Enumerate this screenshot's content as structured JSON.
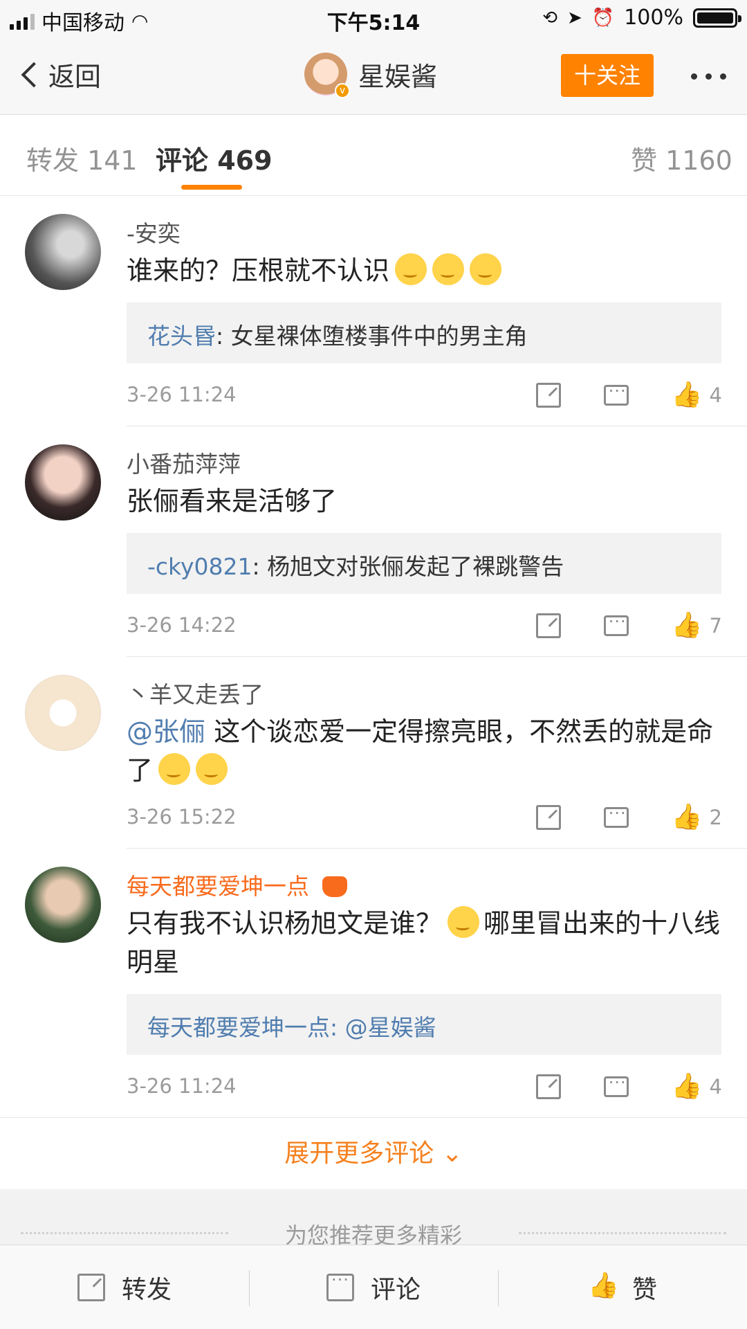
{
  "status_bar": {
    "carrier": "中国移动",
    "time": "下午5:14",
    "battery": "100%"
  },
  "nav": {
    "back_label": "返回",
    "title": "星娱酱",
    "follow_label": "十关注"
  },
  "tabs": [
    {
      "label": "转发 141"
    },
    {
      "label": "评论 469"
    },
    {
      "label": "赞 1160"
    }
  ],
  "comments": [
    {
      "user": "-安奕",
      "text": "谁来的？压根就不认识",
      "reply_name": "花头昬",
      "reply_text": ": 女星裸体堕楼事件中的男主角",
      "time": "3-26 11:24",
      "likes": "4"
    },
    {
      "user": "小番茄萍萍",
      "text": "张俪看来是活够了",
      "reply_name": "-cky0821",
      "reply_text": ": 杨旭文对张俪发起了裸跳警告",
      "time": "3-26 14:22",
      "likes": "7"
    },
    {
      "user": "丶羊又走丢了",
      "mention": "@张俪",
      "text": " 这个谈恋爱一定得擦亮眼，不然丢的就是命了",
      "time": "3-26 15:22",
      "likes": "2"
    },
    {
      "user": "每天都要爱坤一点",
      "text_a": "只有我不认识杨旭文是谁？",
      "text_b": "哪里冒出来的十八线明星",
      "reply_name": "每天都要爱坤一点",
      "reply_text": ": @星娱酱",
      "time": "3-26 11:24",
      "likes": "4"
    }
  ],
  "expand_more": "展开更多评论 ⌄",
  "recommend": "为您推荐更多精彩",
  "toolbar": {
    "repost": "转发",
    "comment": "评论",
    "like": "赞"
  },
  "colors": {
    "accent": "#ff8200",
    "link": "#507daf",
    "vip_name": "#f86b1d"
  }
}
